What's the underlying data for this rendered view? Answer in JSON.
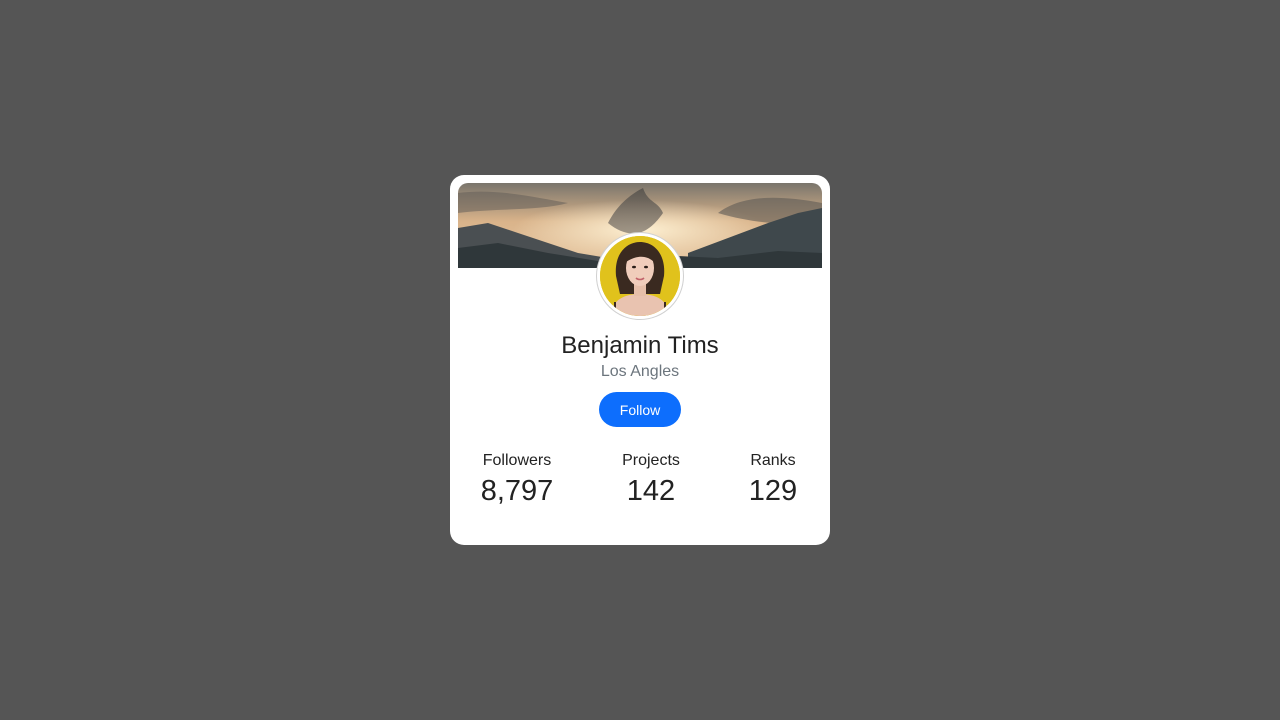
{
  "profile": {
    "name": "Benjamin Tims",
    "location": "Los Angles",
    "follow_label": "Follow",
    "stats": [
      {
        "label": "Followers",
        "value": "8,797"
      },
      {
        "label": "Projects",
        "value": "142"
      },
      {
        "label": "Ranks",
        "value": "129"
      }
    ]
  },
  "colors": {
    "page_background": "#555555",
    "card_background": "#ffffff",
    "accent": "#0d6efd"
  }
}
